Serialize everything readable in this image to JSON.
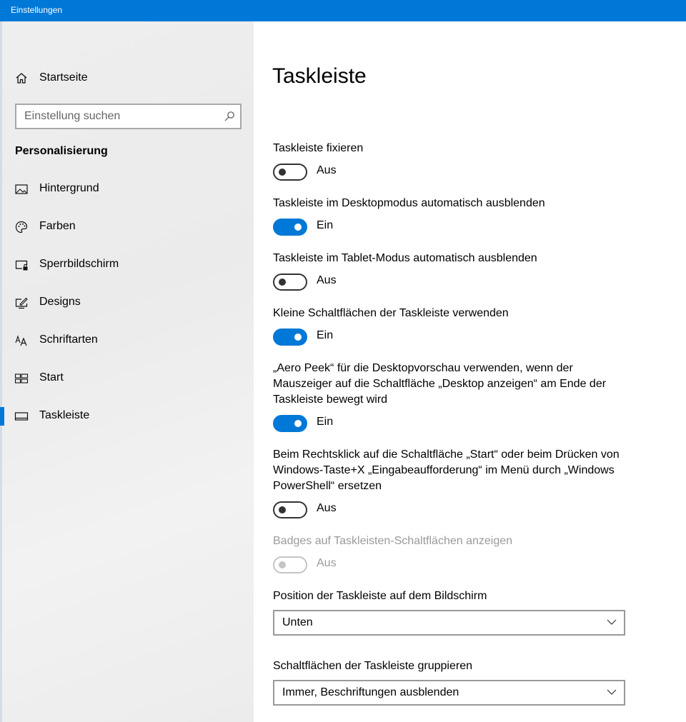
{
  "window": {
    "title": "Einstellungen"
  },
  "sidebar": {
    "home_label": "Startseite",
    "search_placeholder": "Einstellung suchen",
    "section_title": "Personalisierung",
    "items": [
      {
        "label": "Hintergrund",
        "icon": "picture-icon"
      },
      {
        "label": "Farben",
        "icon": "palette-icon"
      },
      {
        "label": "Sperrbildschirm",
        "icon": "lock-screen-icon"
      },
      {
        "label": "Designs",
        "icon": "brush-icon"
      },
      {
        "label": "Schriftarten",
        "icon": "fonts-icon"
      },
      {
        "label": "Start",
        "icon": "start-layout-icon"
      },
      {
        "label": "Taskleiste",
        "icon": "taskbar-icon",
        "active": true
      }
    ]
  },
  "main": {
    "title": "Taskleiste",
    "toggles": [
      {
        "label": "Taskleiste fixieren",
        "state": "Aus",
        "on": false
      },
      {
        "label": "Taskleiste im Desktopmodus automatisch ausblenden",
        "state": "Ein",
        "on": true
      },
      {
        "label": "Taskleiste im Tablet-Modus automatisch ausblenden",
        "state": "Aus",
        "on": false
      },
      {
        "label": "Kleine Schaltflächen der Taskleiste verwenden",
        "state": "Ein",
        "on": true
      },
      {
        "label": "„Aero Peek“ für die Desktopvorschau verwenden, wenn der Mauszeiger auf die Schaltfläche „Desktop anzeigen“ am Ende der Taskleiste bewegt wird",
        "state": "Ein",
        "on": true
      },
      {
        "label": "Beim Rechtsklick auf die Schaltfläche „Start“ oder beim Drücken von Windows-Taste+X „Eingabeaufforderung“ im Menü durch „Windows PowerShell“ ersetzen",
        "state": "Aus",
        "on": false
      },
      {
        "label": "Badges auf Taskleisten-Schaltflächen anzeigen",
        "state": "Aus",
        "on": false,
        "disabled": true
      }
    ],
    "position": {
      "label": "Position der Taskleiste auf dem Bildschirm",
      "value": "Unten"
    },
    "grouping": {
      "label": "Schaltflächen der Taskleiste gruppieren",
      "value": "Immer, Beschriftungen ausblenden"
    }
  },
  "colors": {
    "accent": "#0078d7",
    "sidebar_bg": "#ededed",
    "disabled_text": "#9a9a9a"
  }
}
